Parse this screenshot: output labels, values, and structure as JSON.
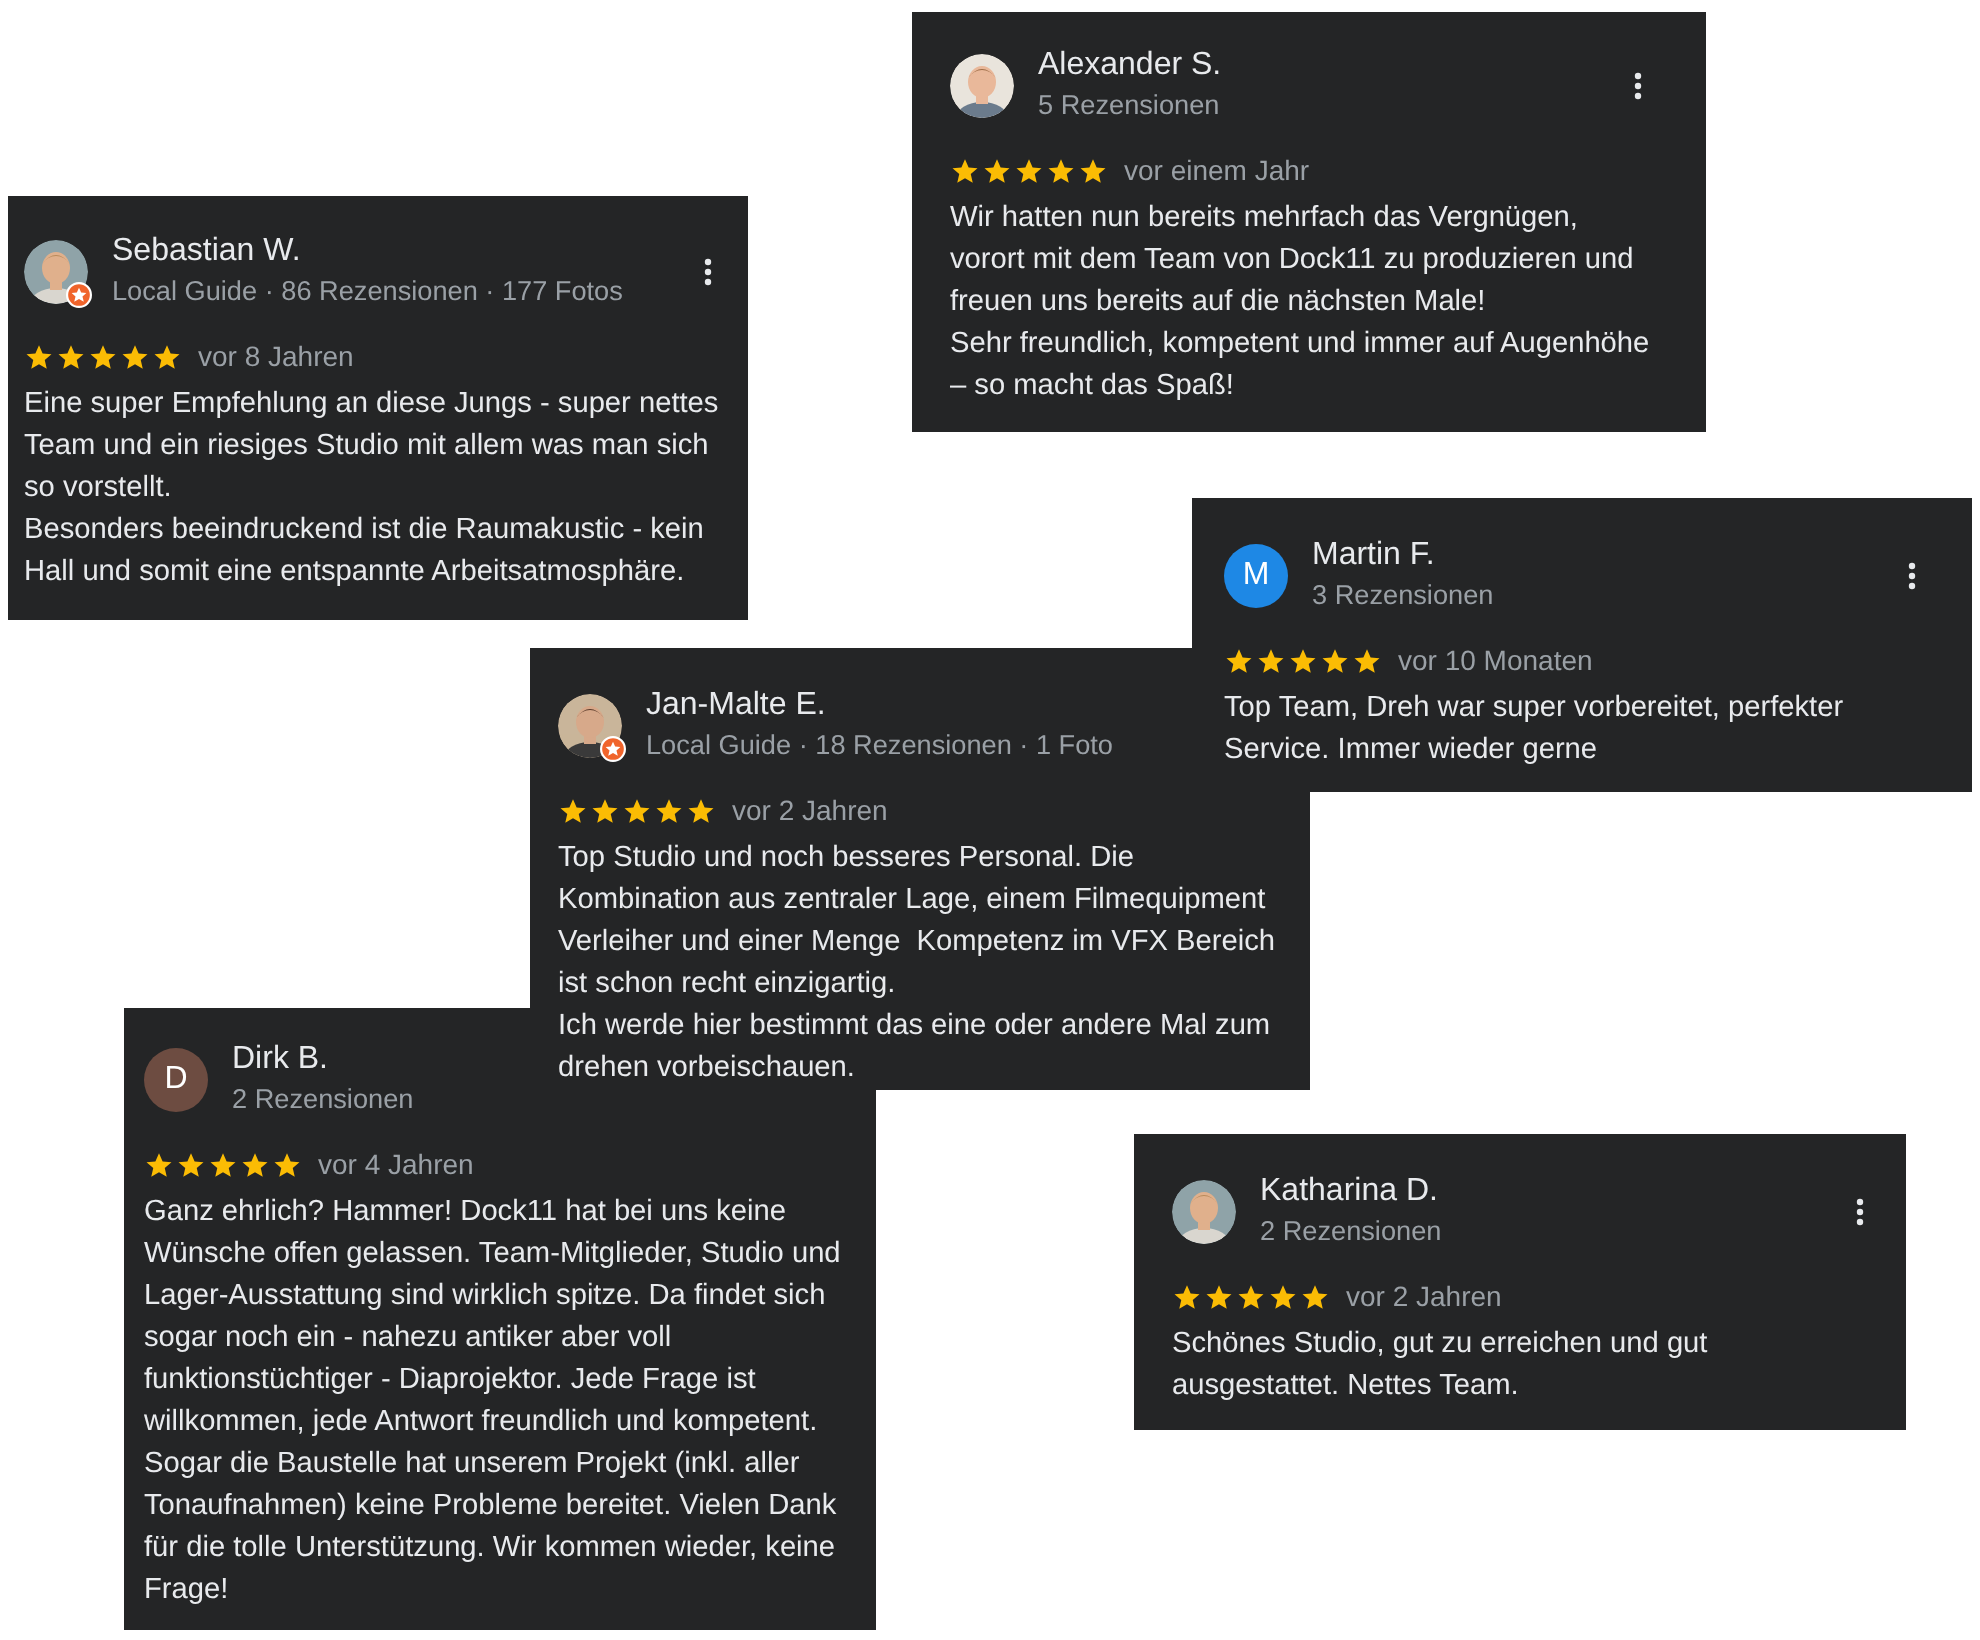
{
  "reviews": [
    {
      "name": "Sebastian W.",
      "subtitle": "Local Guide · 86 Rezensionen · 177 Fotos",
      "avatar": {
        "kind": "picture",
        "badge": true
      },
      "stars": 5,
      "date": "vor 8 Jahren",
      "text": "Eine super Empfehlung an diese Jungs - super nettes Team und ein riesiges Studio mit allem was man sich so vorstellt.\nBesonders beeindruckend ist die Raumakustic - kein Hall und somit eine entspannte Arbeitsatmosphäre."
    },
    {
      "name": "Alexander S.",
      "subtitle": "5 Rezensionen",
      "avatar": {
        "kind": "picture",
        "badge": false
      },
      "stars": 5,
      "date": "vor einem Jahr",
      "text": "Wir hatten nun bereits mehrfach das Vergnügen, vorort mit dem Team von Dock11 zu produzieren und freuen uns bereits auf die nächsten Male!\nSehr freundlich, kompetent und immer auf Augenhöhe – so macht das Spaß!"
    },
    {
      "name": "Dirk B.",
      "subtitle": "2 Rezensionen",
      "avatar": {
        "kind": "initial",
        "initial": "D",
        "color": "#6d4c41",
        "badge": false
      },
      "stars": 5,
      "date": "vor 4 Jahren",
      "text": "Ganz ehrlich? Hammer! Dock11 hat bei uns keine Wünsche offen gelassen. Team-Mitglieder, Studio und Lager-Ausstattung sind wirklich spitze. Da findet sich sogar noch ein - nahezu antiker aber voll funktionstüchtiger - Diaprojektor. Jede Frage ist willkommen, jede Antwort freundlich und kompetent. Sogar die Baustelle hat unserem Projekt (inkl. aller Tonaufnahmen) keine Probleme bereitet. Vielen Dank für die tolle Unterstützung. Wir kommen wieder, keine Frage!"
    },
    {
      "name": "Jan-Malte E.",
      "subtitle": "Local Guide · 18 Rezensionen · 1 Foto",
      "avatar": {
        "kind": "picture",
        "badge": true
      },
      "stars": 5,
      "date": "vor 2 Jahren",
      "text": "Top Studio und noch besseres Personal. Die Kombination aus zentraler Lage, einem Filmequipment Verleiher und einer Menge  Kompetenz im VFX Bereich ist schon recht einzigartig.\nIch werde hier bestimmt das eine oder andere Mal zum drehen vorbeischauen."
    },
    {
      "name": "Martin F.",
      "subtitle": "3 Rezensionen",
      "avatar": {
        "kind": "initial",
        "initial": "M",
        "color": "#1e88e5",
        "badge": false
      },
      "stars": 5,
      "date": "vor 10 Monaten",
      "text": "Top Team, Dreh war super vorbereitet, perfekter Service. Immer wieder gerne"
    },
    {
      "name": "Katharina D.",
      "subtitle": "2 Rezensionen",
      "avatar": {
        "kind": "picture",
        "badge": false
      },
      "stars": 5,
      "date": "vor 2 Jahren",
      "text": "Schönes Studio, gut zu erreichen und gut ausgestattet. Nettes Team."
    }
  ]
}
